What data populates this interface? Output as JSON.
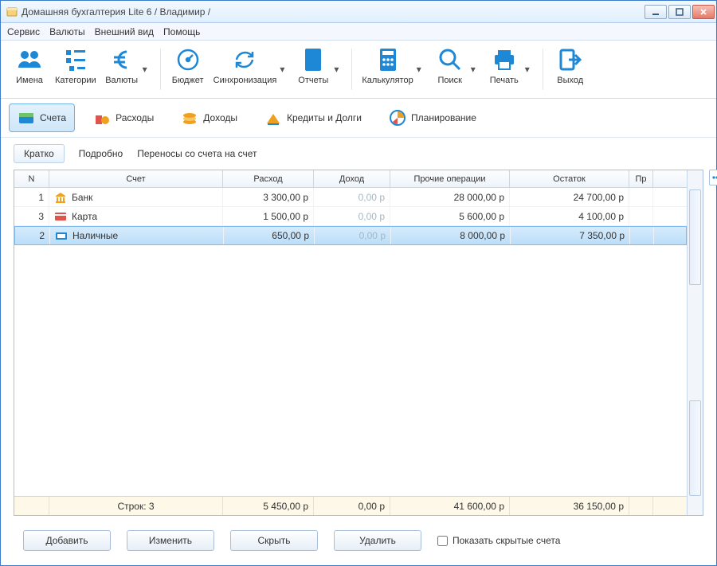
{
  "title": "Домашняя бухгалтерия Lite 6  / Владимир /",
  "menu": {
    "service": "Сервис",
    "currencies": "Валюты",
    "view": "Внешний вид",
    "help": "Помощь"
  },
  "toolbar": {
    "names": "Имена",
    "categories": "Категории",
    "currencies": "Валюты",
    "budget": "Бюджет",
    "sync": "Синхронизация",
    "reports": "Отчеты",
    "calc": "Калькулятор",
    "search": "Поиск",
    "print": "Печать",
    "exit": "Выход"
  },
  "sections": {
    "accounts": "Счета",
    "expenses": "Расходы",
    "incomes": "Доходы",
    "credits": "Кредиты и Долги",
    "planning": "Планирование"
  },
  "views": {
    "brief": "Кратко",
    "detailed": "Подробно",
    "transfers": "Переносы со счета на счет"
  },
  "grid": {
    "headers": {
      "n": "N",
      "account": "Счет",
      "expense": "Расход",
      "income": "Доход",
      "other": "Прочие операции",
      "balance": "Остаток",
      "pr": "Пр"
    },
    "rows": [
      {
        "n": "1",
        "name": "Банк",
        "icon": "bank",
        "expense": "3 300,00 р",
        "income": "0,00 р",
        "other": "28 000,00 р",
        "balance": "24 700,00 р"
      },
      {
        "n": "3",
        "name": "Карта",
        "icon": "card",
        "expense": "1 500,00 р",
        "income": "0,00 р",
        "other": "5 600,00 р",
        "balance": "4 100,00 р"
      },
      {
        "n": "2",
        "name": "Наличные",
        "icon": "cash",
        "expense": "650,00 р",
        "income": "0,00 р",
        "other": "8 000,00 р",
        "balance": "7 350,00 р"
      }
    ],
    "footer": {
      "rows_label": "Строк: 3",
      "expense": "5 450,00 р",
      "income": "0,00 р",
      "other": "41 600,00 р",
      "balance": "36 150,00 р"
    }
  },
  "buttons": {
    "add": "Добавить",
    "edit": "Изменить",
    "hide": "Скрыть",
    "delete": "Удалить"
  },
  "checkbox": {
    "show_hidden": "Показать скрытые счета"
  }
}
